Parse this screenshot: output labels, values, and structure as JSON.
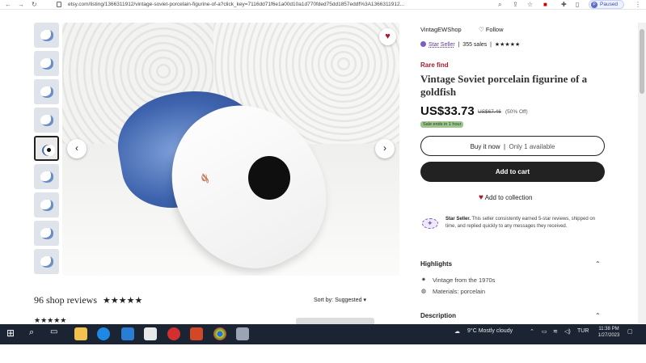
{
  "browser": {
    "url": "etsy.com/listing/1366311912/vintage-soviet-porcelain-figurine-of-a?click_key=7116dd71f6e1a00d10a1d770fded75dd1857eddf%3A1366311912...",
    "profile_initial": "P",
    "profile_status": "Paused"
  },
  "shop": {
    "name": "VintagEWShop",
    "follow_label": "Follow",
    "star_seller_label": "Star Seller",
    "sales": "355 sales",
    "rating_stars": "★★★★★"
  },
  "product": {
    "badge": "Rare find",
    "title": "Vintage Soviet porcelain figurine of a goldfish",
    "price": "US$33.73",
    "original_price": "US$67.46",
    "discount": "(50% Off)",
    "sale_note": "Sale ends in 1 hour",
    "buy_now_label": "Buy it now",
    "availability": "Only 1 available",
    "add_to_cart_label": "Add to cart",
    "add_to_collection_label": "Add to collection"
  },
  "star_seller_info": {
    "title": "Star Seller.",
    "text": "This seller consistently earned 5-star reviews, shipped on time, and replied quickly to any messages they received."
  },
  "highlights": {
    "heading": "Highlights",
    "items": [
      "Vintage from the 1970s",
      "Materials: porcelain"
    ]
  },
  "description": {
    "heading": "Description"
  },
  "reviews": {
    "count_label": "96 shop reviews",
    "stars": "★★★★★",
    "sort_label": "Sort by: Suggested",
    "first_review_stars": "★★★★★"
  },
  "gallery": {
    "thumbnail_count": 9,
    "selected_index": 4
  },
  "taskbar": {
    "weather": "9°C  Mostly cloudy",
    "language": "TUR",
    "time": "11:38 PM",
    "date": "1/27/2023"
  }
}
